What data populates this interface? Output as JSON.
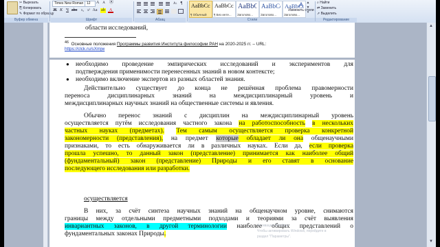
{
  "ribbon": {
    "clipboard": {
      "cut": "Вырезать",
      "copy": "Копировать",
      "format_painter": "Формат по образцу",
      "label": "Буфер обмена"
    },
    "font": {
      "family": "Times New Roman",
      "size": "12",
      "label": "Шрифт"
    },
    "paragraph": {
      "label": "Абзац"
    },
    "styles": {
      "items": [
        {
          "sample": "AaBbCcDc",
          "name": "¶ Обычный"
        },
        {
          "sample": "AaBbCcDc",
          "name": "¶ Без инте..."
        },
        {
          "sample": "AaBbC",
          "name": "Заголово..."
        },
        {
          "sample": "AaBbCc",
          "name": "Заголово..."
        },
        {
          "sample": "AaBbCc",
          "name": "Заголово..."
        }
      ],
      "change_styles": "Изменить стили",
      "label": "Стили"
    },
    "editing": {
      "find": "Найти",
      "replace": "Заменить",
      "select": "Выделить",
      "label": "Редактирование"
    }
  },
  "document": {
    "top_line": "области исследований,",
    "footnote": {
      "num": "46",
      "pre": "Основные положения ",
      "link_text": "Программы развития Института философии РАН",
      "post": " на 2020-2025 гг. – URL:",
      "url": "https://clck.ru/sXmjw"
    },
    "bullets": [
      {
        "l1": "необходимо проведение эмпирических исследований и экспериментов для",
        "l2": "подтверждения применимости перенесенных знаний в новом контексте;"
      },
      {
        "l1": "необходимо включение экспертов из разных областей знания."
      }
    ],
    "para1": {
      "l1": "Действительно существует до конца не решённая проблема правомерности",
      "l2": "переноса дисциплинарных знаний на междисциплинарный уровень и",
      "l3": "междисциплинарных научных знаний на общественные системы и явления."
    },
    "para2": {
      "l1": "Обычно перенос знаний с дисциплин на междисциплинарный уровень",
      "l2a": "осуществляется путём исследования частного закона ",
      "l2h1": "на работоспособность",
      "l2b": " ",
      "l2h2": "в нескольких",
      "l3h": "частных науках (предметах).",
      "l3b": " ",
      "l3h2": "Тем самым осуществляется проверка конкретной",
      "l4h": "закономерности (представления),",
      "l4b": " на предмет ",
      "l4g": "которые",
      "l4h2": " обладает ли она",
      "l4c": " общенаучными",
      "l5a": "признаками, то есть обнаруживается ли в различных науках. Если да, ",
      "l5h": "если проверка",
      "l6h": "прошла успешно, то данный закон (представление) принимается как наиболее общий",
      "l7h": "(фундаментальный) закон (представление) Природы и его ставят в основание",
      "l8h": "последующего исследования или разработки."
    },
    "heading": "осуществляется",
    "para3": {
      "l1": "В них, за счёт синтеза научных знаний на общенаучном уровне, снимаются",
      "l2": "границы между отдельными предметными подходами и теориями за счёт выявления",
      "l3c": "инвариантных законов, в другой терминологии",
      "l3b": " наиболее общих представлений о",
      "l4a": "фундаментальных законах Природы",
      "l4h": "."
    }
  },
  "watermark": {
    "line1": "Активация Windows",
    "line2": "Чтобы активировать Windows, перейдите в",
    "line3": "раздел \"Параметры\"."
  },
  "colors": {
    "highlight": "#ffff00",
    "cyan": "#00ffff",
    "ribbon": "#dfe8f5",
    "workspace": "#abb5c6"
  }
}
